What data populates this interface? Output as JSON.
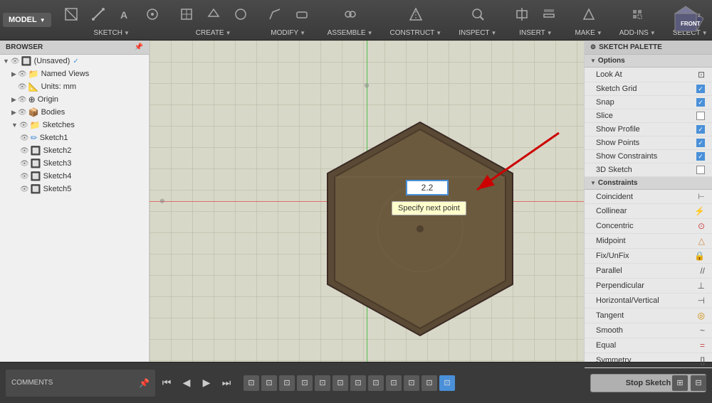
{
  "toolbar": {
    "model_label": "MODEL",
    "sketch_label": "SKETCH",
    "create_label": "CREATE",
    "modify_label": "MODIFY",
    "assemble_label": "ASSEMBLE",
    "construct_label": "CONSTRUCT",
    "inspect_label": "INSPECT",
    "insert_label": "INSERT",
    "make_label": "MAKE",
    "addins_label": "ADD-INS",
    "select_label": "SELECT",
    "stop_sketch_label": "STOP SKETCH"
  },
  "browser": {
    "header_label": "BROWSER",
    "unsaved_label": "(Unsaved)",
    "named_views_label": "Named Views",
    "units_label": "Units: mm",
    "origin_label": "Origin",
    "bodies_label": "Bodies",
    "sketches_label": "Sketches",
    "sketch1_label": "Sketch1",
    "sketch2_label": "Sketch2",
    "sketch3_label": "Sketch3",
    "sketch4_label": "Sketch4",
    "sketch5_label": "Sketch5"
  },
  "canvas": {
    "input_value": "2.2",
    "tooltip_text": "Specify next point",
    "axis_z": "Z"
  },
  "palette": {
    "header_label": "SKETCH PALETTE",
    "options_label": "Options",
    "constraints_label": "Constraints",
    "look_at_label": "Look At",
    "sketch_grid_label": "Sketch Grid",
    "snap_label": "Snap",
    "slice_label": "Slice",
    "show_profile_label": "Show Profile",
    "show_points_label": "Show Points",
    "show_constraints_label": "Show Constraints",
    "sketch_3d_label": "3D Sketch",
    "coincident_label": "Coincident",
    "collinear_label": "Collinear",
    "concentric_label": "Concentric",
    "midpoint_label": "Midpoint",
    "fix_unfix_label": "Fix/UnFix",
    "parallel_label": "Parallel",
    "perpendicular_label": "Perpendicular",
    "horizontal_vertical_label": "Horizontal/Vertical",
    "tangent_label": "Tangent",
    "smooth_label": "Smooth",
    "equal_label": "Equal",
    "symmetry_label": "Symmetry",
    "stop_sketch_label": "Stop Sketch",
    "sketch_grid_checked": true,
    "snap_checked": true,
    "slice_checked": false,
    "show_profile_checked": true,
    "show_points_checked": true,
    "show_constraints_checked": true,
    "sketch_3d_checked": false
  },
  "bottom": {
    "comments_label": "COMMENTS",
    "timeline_icons": [
      "⬡",
      "⬡",
      "⬡",
      "⬡",
      "⬡",
      "⬡",
      "⬡",
      "⬡",
      "⬡",
      "⬡",
      "⬡",
      "⬡"
    ]
  }
}
